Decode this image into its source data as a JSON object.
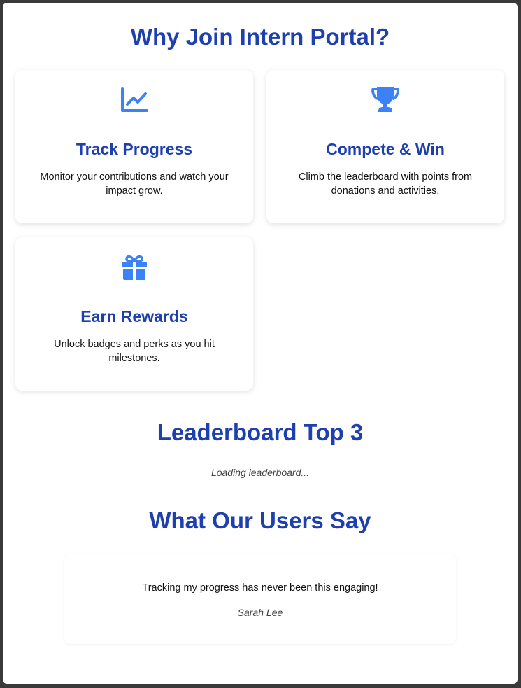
{
  "features": {
    "heading": "Why Join Intern Portal?",
    "items": [
      {
        "icon": "chart-line-icon",
        "title": "Track Progress",
        "description": "Monitor your contributions and watch your impact grow."
      },
      {
        "icon": "trophy-icon",
        "title": "Compete & Win",
        "description": "Climb the leaderboard with points from donations and activities."
      },
      {
        "icon": "gift-icon",
        "title": "Earn Rewards",
        "description": "Unlock badges and perks as you hit milestones."
      }
    ]
  },
  "leaderboard": {
    "heading": "Leaderboard Top 3",
    "loading_text": "Loading leaderboard..."
  },
  "testimonials": {
    "heading": "What Our Users Say",
    "items": [
      {
        "quote": "Tracking my progress has never been this engaging!",
        "author": "Sarah Lee"
      }
    ]
  },
  "colors": {
    "heading": "#1e40af",
    "icon": "#3b82f6",
    "text": "#111111",
    "muted": "#444444"
  }
}
